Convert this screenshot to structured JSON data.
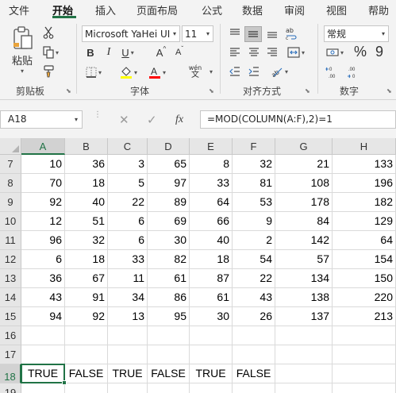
{
  "tabs": [
    "文件",
    "开始",
    "插入",
    "页面布局",
    "公式",
    "数据",
    "审阅",
    "视图",
    "帮助"
  ],
  "active_tab": "开始",
  "ribbon": {
    "clipboard": {
      "paste_label": "粘贴",
      "group_label": "剪贴板"
    },
    "font": {
      "font_name": "Microsoft YaHei UI",
      "font_size": "11",
      "bold": "B",
      "italic": "I",
      "underline": "U",
      "grow": "A",
      "shrink": "A",
      "wen": "wén",
      "group_label": "字体"
    },
    "alignment": {
      "group_label": "对齐方式"
    },
    "number": {
      "format": "常规",
      "percent": "%",
      "comma": "9",
      "group_label": "数字"
    }
  },
  "name_box": "A18",
  "fx_label": "fx",
  "formula": "=MOD(COLUMN(A:F),2)=1",
  "columns": [
    "A",
    "B",
    "C",
    "D",
    "E",
    "F",
    "G",
    "H"
  ],
  "selected_column": "A",
  "selected_row": "18",
  "rows": [
    {
      "num": "7",
      "cells": [
        "10",
        "36",
        "3",
        "65",
        "8",
        "32",
        "21",
        "133"
      ]
    },
    {
      "num": "8",
      "cells": [
        "70",
        "18",
        "5",
        "97",
        "33",
        "81",
        "108",
        "196"
      ]
    },
    {
      "num": "9",
      "cells": [
        "92",
        "40",
        "22",
        "89",
        "64",
        "53",
        "178",
        "182"
      ]
    },
    {
      "num": "10",
      "cells": [
        "12",
        "51",
        "6",
        "69",
        "66",
        "9",
        "84",
        "129"
      ]
    },
    {
      "num": "11",
      "cells": [
        "96",
        "32",
        "6",
        "30",
        "40",
        "2",
        "142",
        "64"
      ]
    },
    {
      "num": "12",
      "cells": [
        "6",
        "18",
        "33",
        "82",
        "18",
        "54",
        "57",
        "154"
      ]
    },
    {
      "num": "13",
      "cells": [
        "36",
        "67",
        "11",
        "61",
        "87",
        "22",
        "134",
        "150"
      ]
    },
    {
      "num": "14",
      "cells": [
        "43",
        "91",
        "34",
        "86",
        "61",
        "43",
        "138",
        "220"
      ]
    },
    {
      "num": "15",
      "cells": [
        "94",
        "92",
        "13",
        "95",
        "30",
        "26",
        "137",
        "213"
      ]
    },
    {
      "num": "16",
      "cells": [
        "",
        "",
        "",
        "",
        "",
        "",
        "",
        ""
      ]
    },
    {
      "num": "17",
      "cells": [
        "",
        "",
        "",
        "",
        "",
        "",
        "",
        ""
      ]
    },
    {
      "num": "18",
      "cells": [
        "TRUE",
        "FALSE",
        "TRUE",
        "FALSE",
        "TRUE",
        "FALSE",
        "",
        ""
      ]
    },
    {
      "num": "19",
      "cells": [
        "",
        "",
        "",
        "",
        "",
        "",
        "",
        ""
      ]
    }
  ],
  "colors": {
    "accent": "#217346",
    "font_highlight": "#ffff00",
    "font_color": "#ff0000"
  }
}
